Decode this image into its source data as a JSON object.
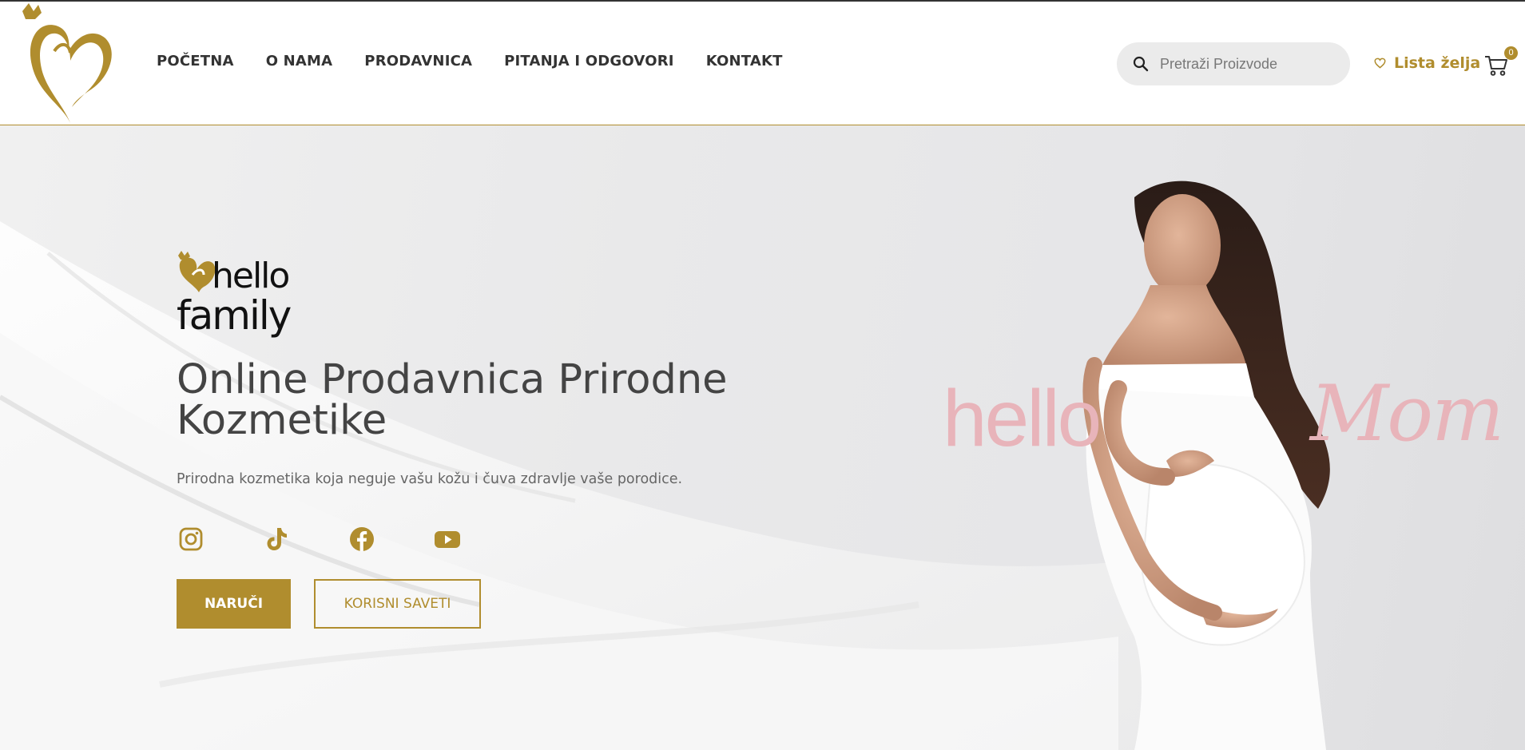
{
  "header": {
    "nav": [
      "POČETNA",
      "O NAMA",
      "PRODAVNICA",
      "PITANJA I ODGOVORI",
      "KONTAKT"
    ],
    "search_placeholder": "Pretraži Proizvode",
    "wishlist_label": "Lista želja",
    "cart_count": "0"
  },
  "hero": {
    "brand_logo_text": "hello family",
    "title": "Online Prodavnica Prirodne Kozmetike",
    "subtitle": "Prirodna kozmetika koja neguje vašu kožu i čuva zdravlje vaše porodice.",
    "social_icons": [
      "instagram-icon",
      "tiktok-icon",
      "facebook-icon",
      "youtube-icon"
    ],
    "primary_button": "NARUČI",
    "secondary_button": "KORISNI SAVETI",
    "image_overlay_word_left": "hello",
    "image_overlay_word_right": "Mom"
  },
  "colors": {
    "accent": "#b08d2e",
    "nav_text": "#333333",
    "heading": "#444444",
    "overlay_pink": "#e8b4ba"
  }
}
